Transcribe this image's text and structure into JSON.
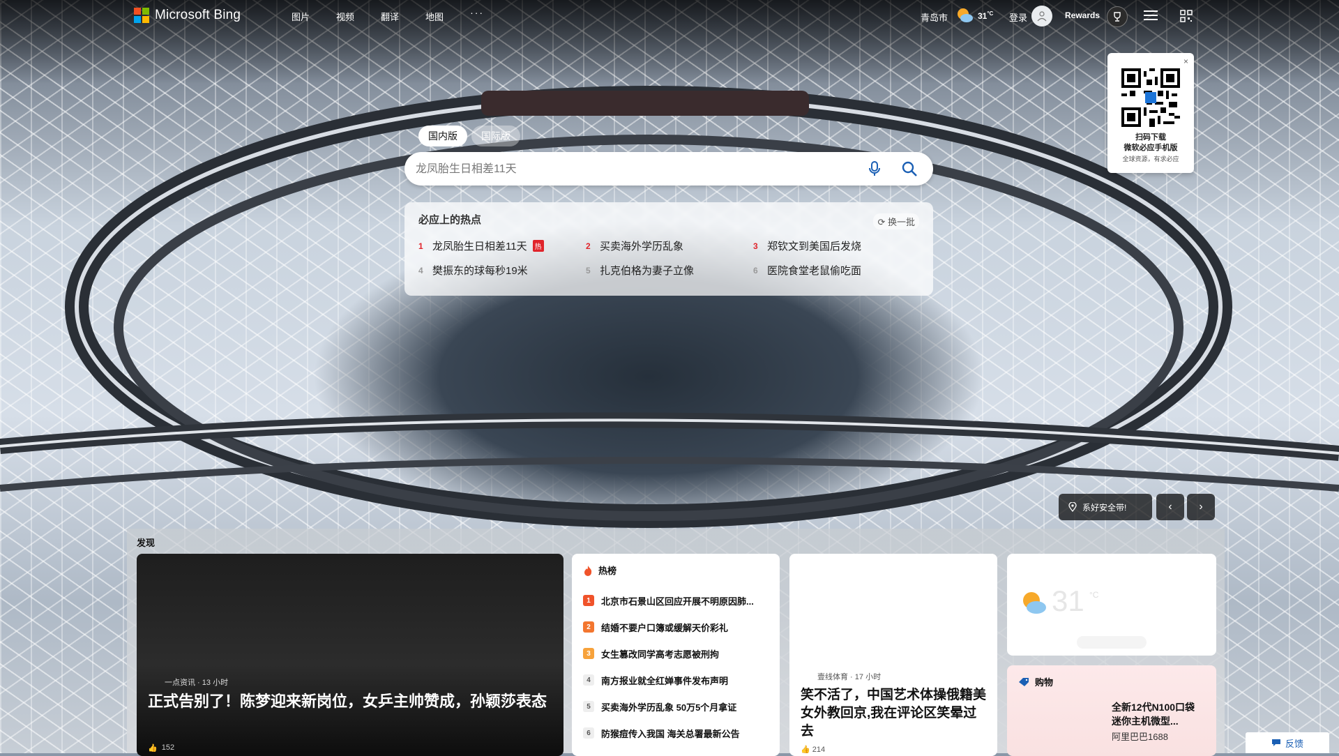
{
  "header": {
    "logo_text": "Microsoft Bing",
    "nav": [
      "图片",
      "视频",
      "翻译",
      "地图"
    ],
    "nav_more": "···",
    "city": "青岛市",
    "temperature": "31",
    "temp_unit": "°C",
    "login": "登录",
    "rewards": "Rewards"
  },
  "qr_popup": {
    "line1": "扫码下载",
    "line2": "微软必应手机版",
    "line3": "全球资源，有求必应",
    "close": "×"
  },
  "search": {
    "tabs": [
      "国内版",
      "国际版"
    ],
    "active_tab": "国内版",
    "placeholder": "龙凤胎生日相差11天"
  },
  "hot": {
    "title": "必应上的热点",
    "refresh": "换一批",
    "badge": "热",
    "items": [
      {
        "num": "1",
        "text": "龙凤胎生日相差11天"
      },
      {
        "num": "2",
        "text": "买卖海外学历乱象"
      },
      {
        "num": "3",
        "text": "郑钦文到美国后发烧"
      },
      {
        "num": "4",
        "text": "樊振东的球每秒19米"
      },
      {
        "num": "5",
        "text": "扎克伯格为妻子立像"
      },
      {
        "num": "6",
        "text": "医院食堂老鼠偷吃面"
      }
    ]
  },
  "carousel": {
    "location_label": "系好安全带!"
  },
  "feed": {
    "discover": "发现",
    "main": {
      "source": "一点资讯 · 13 小时",
      "title": "正式告别了！陈梦迎来新岗位，女乒主帅赞成，孙颖莎表态",
      "likes": "152"
    },
    "hotlist": {
      "title": "热榜",
      "items": [
        {
          "num": "1",
          "text": "北京市石景山区回应开展不明原因肺..."
        },
        {
          "num": "2",
          "text": "结婚不要户口簿或缓解天价彩礼"
        },
        {
          "num": "3",
          "text": "女生篡改同学高考志愿被刑拘"
        },
        {
          "num": "4",
          "text": "南方报业就全红婵事件发布声明"
        },
        {
          "num": "5",
          "text": "买卖海外学历乱象 50万5个月拿证"
        },
        {
          "num": "6",
          "text": "防猴痘传入我国 海关总署最新公告"
        }
      ]
    },
    "sport": {
      "source": "壹线体育 · 17 小时",
      "title": "笑不活了，中国艺术体操俄籍美女外教回京,我在评论区笑晕过去",
      "likes": "214"
    },
    "weather": {
      "temp": "31",
      "unit": "°C"
    },
    "shopping": {
      "title": "购物",
      "product": "全新12代N100口袋迷你主机微型...",
      "shop": "阿里巴巴1688"
    }
  },
  "feedback": "反馈"
}
